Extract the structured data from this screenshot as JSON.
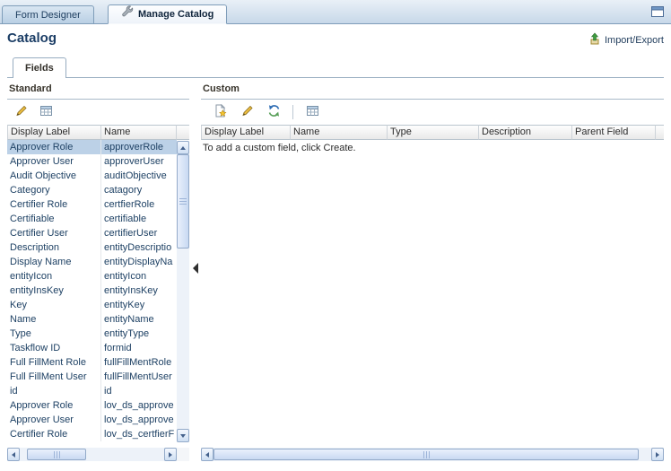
{
  "colors": {
    "title_color": "#1c3e66",
    "row_text": "#1e4164",
    "selected_row": "#bcd1e7",
    "panel_line": "#a9bac9",
    "tab_border": "#7f9db9",
    "link_color": "#24405f",
    "header_text": "#2b2b2b",
    "panel_title": "#38342b"
  },
  "tabbar": {
    "tabs": [
      {
        "label": "Form Designer",
        "active": false
      },
      {
        "label": "Manage Catalog",
        "active": true
      }
    ]
  },
  "header": {
    "title": "Catalog",
    "import_export": "Import/Export"
  },
  "subtab": {
    "label": "Fields"
  },
  "standard_panel": {
    "title": "Standard",
    "columns": [
      "Display Label",
      "Name"
    ],
    "rows": [
      {
        "display_label": "Approver Role",
        "name": "approverRole",
        "selected": true
      },
      {
        "display_label": "Approver User",
        "name": "approverUser"
      },
      {
        "display_label": "Audit Objective",
        "name": "auditObjective"
      },
      {
        "display_label": "Category",
        "name": "catagory"
      },
      {
        "display_label": "Certifier Role",
        "name": "certfierRole"
      },
      {
        "display_label": "Certifiable",
        "name": "certifiable"
      },
      {
        "display_label": "Certifier User",
        "name": "certifierUser"
      },
      {
        "display_label": "Description",
        "name": "entityDescriptio"
      },
      {
        "display_label": "Display Name",
        "name": "entityDisplayNa"
      },
      {
        "display_label": "entityIcon",
        "name": "entityIcon"
      },
      {
        "display_label": "entityInsKey",
        "name": "entityInsKey"
      },
      {
        "display_label": "Key",
        "name": "entityKey"
      },
      {
        "display_label": "Name",
        "name": "entityName"
      },
      {
        "display_label": "Type",
        "name": "entityType"
      },
      {
        "display_label": "Taskflow ID",
        "name": "formid"
      },
      {
        "display_label": "Full FillMent Role",
        "name": "fullFillMentRole"
      },
      {
        "display_label": "Full FillMent User",
        "name": "fullFillMentUser"
      },
      {
        "display_label": "id",
        "name": "id"
      },
      {
        "display_label": "Approver Role",
        "name": "lov_ds_approve"
      },
      {
        "display_label": "Approver User",
        "name": "lov_ds_approve"
      },
      {
        "display_label": "Certifier Role",
        "name": "lov_ds_certfierF"
      }
    ]
  },
  "custom_panel": {
    "title": "Custom",
    "columns": [
      "Display Label",
      "Name",
      "Type",
      "Description",
      "Parent Field"
    ],
    "empty_text": "To add a custom field, click Create."
  },
  "icons": {
    "wrench-icon": "wrench",
    "window-icon": "window-with-titlebar",
    "import-export-icon": "green-up-arrow-over-box",
    "pencil-icon": "yellow-pencil",
    "detach-icon": "table-grid",
    "create-icon": "page-with-gold-star",
    "refresh-icon": "two-circular-arrows",
    "collapse-icon": "left-triangle",
    "scroll-arrows": "triangles"
  }
}
